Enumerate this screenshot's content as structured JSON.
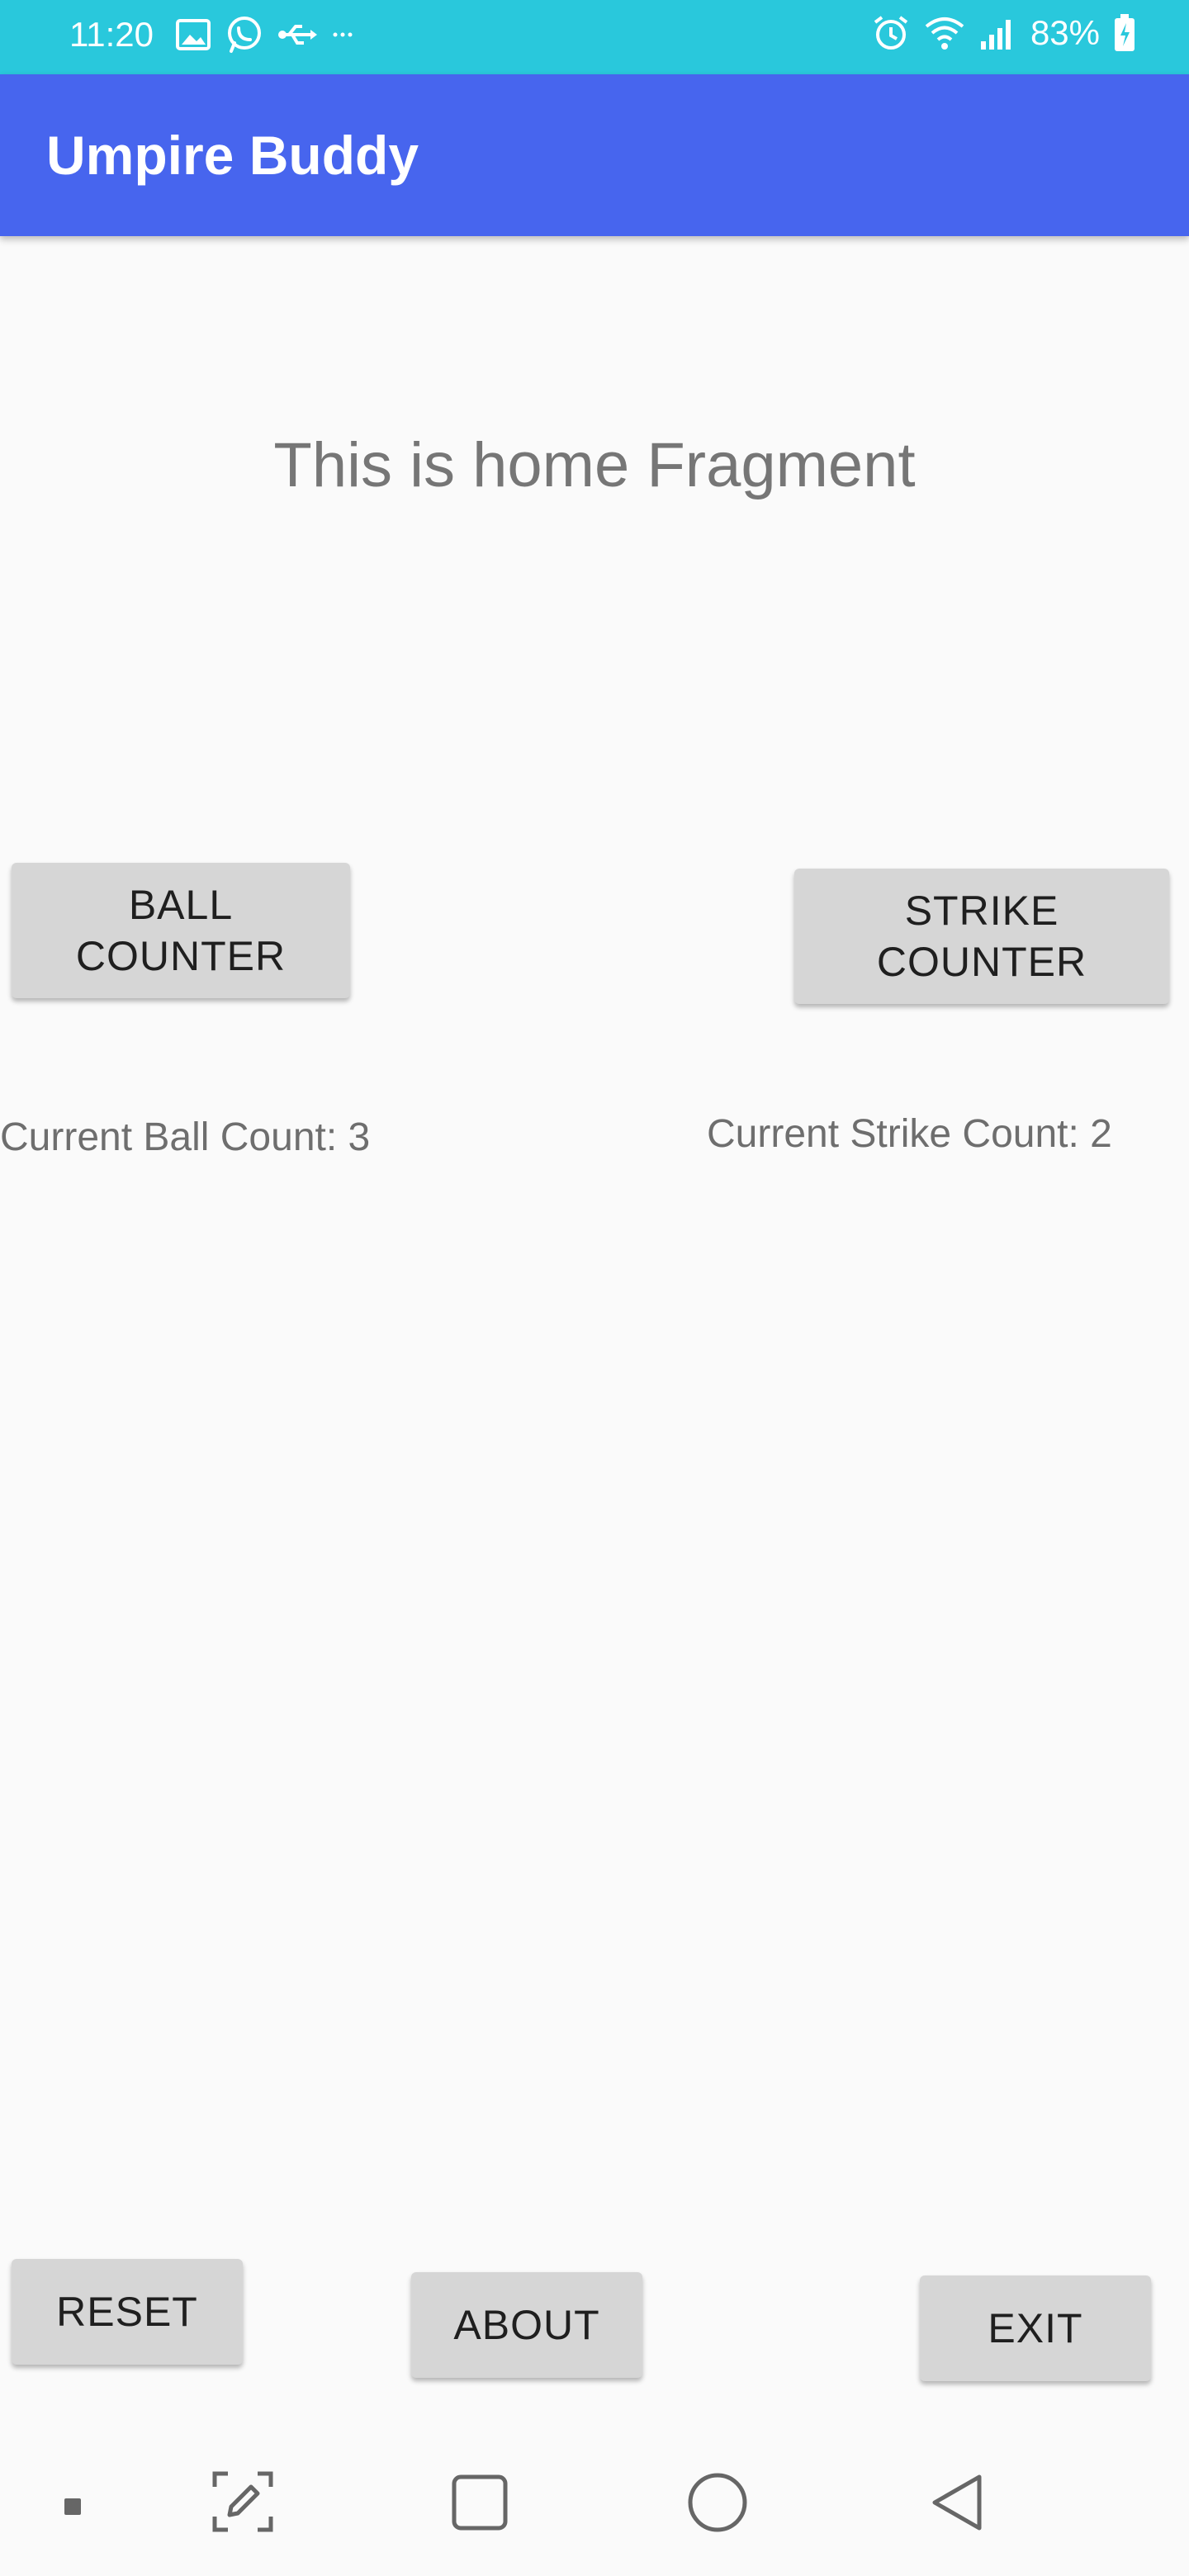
{
  "status_bar": {
    "time": "11:20",
    "battery": "83%",
    "icons_left": [
      "image-icon",
      "whatsapp-icon",
      "usb-icon",
      "more-icon"
    ],
    "icons_right": [
      "alarm-icon",
      "wifi-icon",
      "signal-icon",
      "battery-icon"
    ],
    "color": "#29c8dc"
  },
  "app_bar": {
    "title": "Umpire Buddy",
    "color": "#4765ee"
  },
  "home": {
    "fragment_text": "This is home Fragment"
  },
  "counters": {
    "ball_button": "BALL\nCOUNTER",
    "strike_button": "STRIKE\nCOUNTER",
    "ball_count_text": "Current Ball Count: 3",
    "strike_count_text": "Current Strike Count: 2"
  },
  "actions": {
    "reset": "RESET",
    "about": "ABOUT",
    "exit": "EXIT"
  },
  "nav_bar": {
    "items": [
      "dot-icon",
      "screenshot-edit-icon",
      "recents-icon",
      "home-icon",
      "back-icon"
    ]
  }
}
